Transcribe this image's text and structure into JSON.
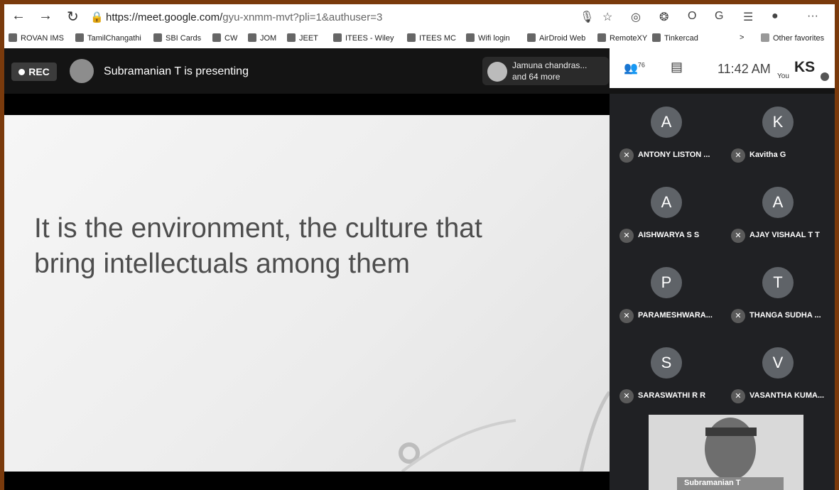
{
  "browser": {
    "url_host": "https://meet.google.com/",
    "url_path": "gyu-xnmm-mvt?pli=1&authuser=3",
    "bookmarks": [
      "ROVAN IMS",
      "TamilChangathi",
      "SBI Cards",
      "CW",
      "JOM",
      "JEET",
      "ITEES - Wiley",
      "ITEES MC",
      "Wifi login",
      "AirDroid Web",
      "RemoteXY",
      "Tinkercad"
    ],
    "other_favorites": "Other favorites"
  },
  "meet": {
    "rec_label": "REC",
    "presenting_text": "Subramanian T is presenting",
    "joined_line1": "Jamuna chandras...",
    "joined_line2": "and 64 more",
    "people_count": "76",
    "time": "11:42 AM",
    "you_label": "You",
    "self_initials": "KS",
    "slide_line1": "It is the environment, the culture that",
    "slide_line2": "bring intellectuals among them",
    "participants": [
      {
        "initial": "A",
        "name": "ANTONY LISTON ..."
      },
      {
        "initial": "K",
        "name": "Kavitha G"
      },
      {
        "initial": "A",
        "name": "AISHWARYA S S"
      },
      {
        "initial": "A",
        "name": "AJAY VISHAAL T T"
      },
      {
        "initial": "P",
        "name": "PARAMESHWARA..."
      },
      {
        "initial": "T",
        "name": "THANGA SUDHA ..."
      },
      {
        "initial": "S",
        "name": "SARASWATHI R R"
      },
      {
        "initial": "V",
        "name": "VASANTHA KUMA..."
      }
    ],
    "self_view_name": "Subramanian T"
  }
}
